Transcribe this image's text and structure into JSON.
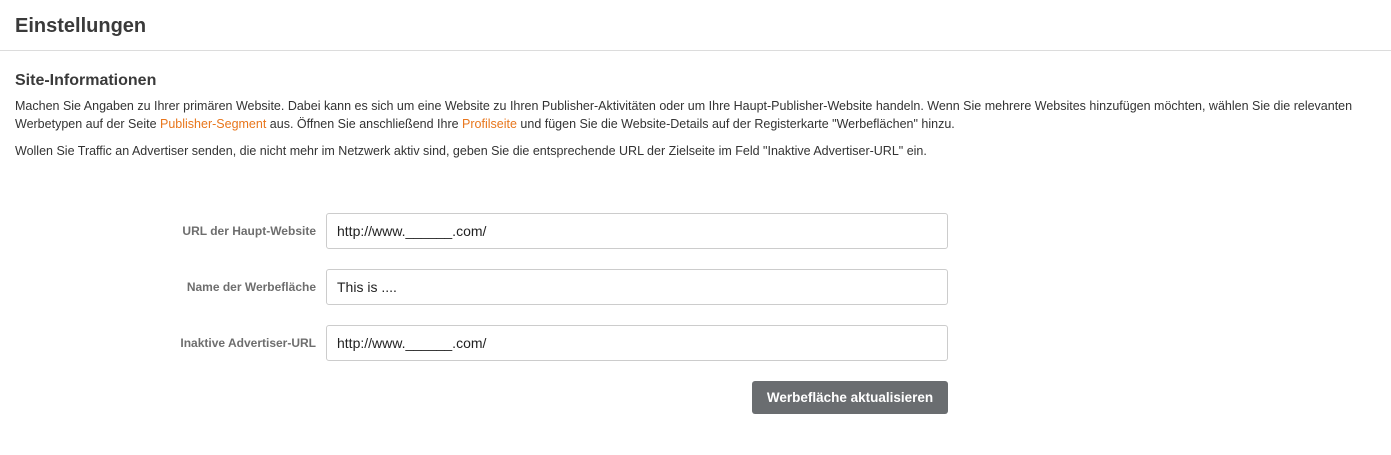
{
  "header": {
    "title": "Einstellungen"
  },
  "site_info": {
    "title": "Site-Informationen",
    "para1_part1": "Machen Sie Angaben zu Ihrer primären Website. Dabei kann es sich um eine Website zu Ihren Publisher-Aktivitäten oder um Ihre Haupt-Publisher-Website handeln. Wenn Sie mehrere Websites hinzufügen möchten, wählen Sie die relevanten Werbetypen auf der Seite ",
    "link_publisher_segment": "Publisher-Segment",
    "para1_part2": " aus. Öffnen Sie anschließend Ihre ",
    "link_profilseite": "Profilseite",
    "para1_part3": " und fügen Sie die Website-Details auf der Registerkarte \"Werbeflächen\" hinzu.",
    "para2": "Wollen Sie Traffic an Advertiser senden, die nicht mehr im Netzwerk aktiv sind, geben Sie die entsprechende URL der Zielseite im Feld \"Inaktive Advertiser-URL\" ein."
  },
  "form": {
    "main_url_label": "URL der Haupt-Website",
    "main_url_value": "http://www.______.com/",
    "adspace_name_label": "Name der Werbefläche",
    "adspace_name_value": "This is ....",
    "inactive_url_label": "Inaktive Advertiser-URL",
    "inactive_url_value": "http://www.______.com/",
    "submit_label": "Werbefläche aktualisieren"
  },
  "colors": {
    "link": "#e8761c",
    "button_bg": "#6a6d70"
  }
}
